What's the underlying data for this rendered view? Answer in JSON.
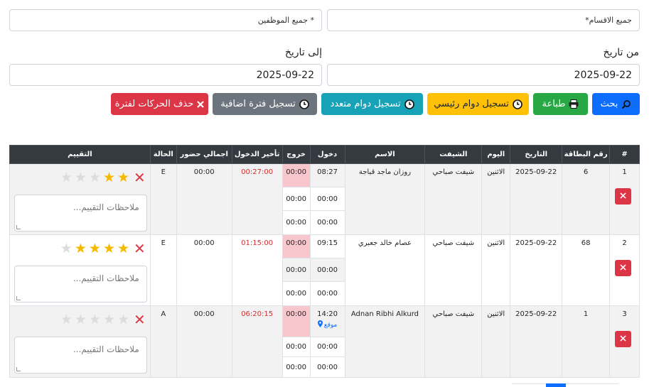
{
  "filters": {
    "departments": "جميع الاقسام*",
    "employees": "* جميع الموظفين",
    "from_label": "من تاريخ",
    "to_label": "إلى تاريخ",
    "from_date": "2025-09-22",
    "to_date": "2025-09-22"
  },
  "actions": {
    "search": "بحث",
    "print": "طباعة",
    "primary_shift": "تسجيل دوام رئيسي",
    "multi_shift": "تسجيل دوام متعدد",
    "extra_period": "تسجيل فترة اضافية",
    "delete_period": "حذف الحركات لفترة"
  },
  "table": {
    "headers": {
      "hash": "#",
      "card": "رقم البطاقة",
      "date": "التاريخ",
      "day": "اليوم",
      "shift": "الشيفت",
      "name": "الاسم",
      "in": "دخول",
      "out": "خروج",
      "late": "تأخير الدخول",
      "total": "اجمالي حضور",
      "status": "الحالة",
      "rating": "التقييم"
    },
    "rows": [
      {
        "num": "1",
        "card": "6",
        "date": "2025-09-22",
        "day": "الاثنين",
        "shift": "شيفت صباحي",
        "name": "روزان ماجد قباجة",
        "ins": [
          "08:27",
          "00:00",
          "00:00"
        ],
        "outs": [
          "00:00",
          "00:00",
          "00:00"
        ],
        "late": "00:27:00",
        "total": "00:00",
        "status": "E",
        "stars": 2,
        "note_placeholder": "ملاحظات التقييم..."
      },
      {
        "num": "2",
        "card": "68",
        "date": "2025-09-22",
        "day": "الاثنين",
        "shift": "شيفت صباحي",
        "name": "عصام خالد جعبري",
        "ins": [
          "09:15",
          "00:00",
          "00:00"
        ],
        "outs": [
          "00:00",
          "00:00",
          "00:00"
        ],
        "late": "01:15:00",
        "total": "00:00",
        "status": "E",
        "stars": 4,
        "note_placeholder": "ملاحظات التقييم..."
      },
      {
        "num": "3",
        "card": "1",
        "date": "2025-09-22",
        "day": "الاثنين",
        "shift": "شيفت صباحي",
        "name": "Adnan Ribhi Alkurd",
        "ins": [
          "14:20",
          "00:00",
          "00:00"
        ],
        "outs": [
          "00:00",
          "00:00",
          "00:00"
        ],
        "location": "موقع",
        "late": "06:20:15",
        "total": "00:00",
        "status": "A",
        "stars": 0,
        "note_placeholder": "ملاحظات التقييم..."
      }
    ]
  },
  "colors": {
    "search": "#0d6efd",
    "print": "#28a745",
    "primary": "#ffc107",
    "multi": "#17a2b8",
    "extra": "#6c757d",
    "delete": "#dc3545",
    "star_on": "#f5b800",
    "star_off": "#dcdcdc",
    "out_highlight": "#f8c6cd"
  },
  "icons": {
    "search": "magnifier-icon",
    "print": "printer-icon",
    "clock": "clock-icon",
    "delete": "x-icon",
    "location": "map-pin-icon",
    "star": "star-icon"
  }
}
